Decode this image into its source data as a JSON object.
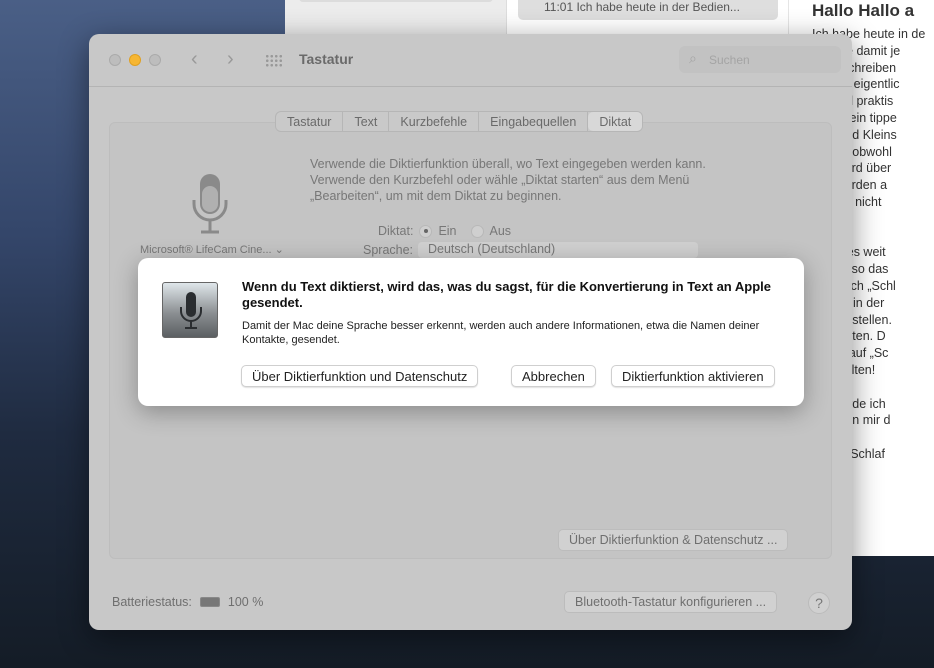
{
  "background_app": {
    "list_item": "11:01  Ich habe heute in der Bedien...",
    "doc_title": "Hallo Hallo a",
    "doc_text": "Ich habe heute in de\nmöchte damit je\nnicht schreiben\nwie sie eigentlic\nen total praktis\nselber ein tippe\nroß- und Kleins\nr groß, obwohl\ndem wird über\nmal werden a\nt etwas nicht \nüfen.\n\nt geht es weit\nen, wieso das\nWenn ich „Schl\nikrofon in der\nhlaf einstellen.\nufleuchten. D\nnn ich auf „Sc\nusschalten!\n\ncht werde ich\ncht kann mir d\n\nchen - Schlaf"
  },
  "window": {
    "title": "Tastatur",
    "search_placeholder": "Suchen",
    "tabs": [
      "Tastatur",
      "Text",
      "Kurzbefehle",
      "Eingabequellen",
      "Diktat"
    ],
    "active_tab": "Diktat",
    "description": "Verwende die Diktierfunktion überall, wo Text eingegeben werden kann.\nVerwende den Kurzbefehl oder wähle „Diktat starten“ aus dem Menü\n„Bearbeiten“, um mit dem Diktat zu beginnen.",
    "microphone_source": "Microsoft® LifeCam Cine... ⌄",
    "dictation_label": "Diktat:",
    "option_on": "Ein",
    "option_off": "Aus",
    "language_label": "Sprache:",
    "language_value": "Deutsch (Deutschland)",
    "privacy_button": "Über Diktierfunktion & Datenschutz ...",
    "battery_label": "Batteriestatus:",
    "battery_value": "100 %",
    "battery_percent": 100,
    "bluetooth_button": "Bluetooth-Tastatur konfigurieren ...",
    "help": "?"
  },
  "dialog": {
    "title": "Wenn du Text diktierst, wird das, was du sagst, für die Konvertierung in Text an Apple gesendet.",
    "text": "Damit der Mac deine Sprache besser erkennt, werden auch andere Informationen, etwa die Namen deiner Kontakte, gesendet.",
    "btn_privacy": "Über Diktierfunktion und Datenschutz",
    "btn_cancel": "Abbrechen",
    "btn_enable": "Diktierfunktion aktivieren"
  }
}
